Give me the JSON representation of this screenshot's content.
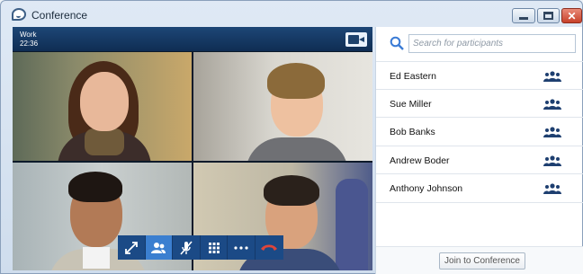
{
  "window": {
    "title": "Conference",
    "close_glyph": "✕"
  },
  "call": {
    "name": "Work",
    "time": "22:36"
  },
  "controls": [
    {
      "id": "expand",
      "icon": "expand-icon"
    },
    {
      "id": "participants",
      "icon": "participants-icon",
      "active": true
    },
    {
      "id": "mute",
      "icon": "microphone-muted-icon"
    },
    {
      "id": "dialpad",
      "icon": "dialpad-icon"
    },
    {
      "id": "more",
      "icon": "more-icon"
    },
    {
      "id": "hangup",
      "icon": "hangup-icon"
    }
  ],
  "search": {
    "placeholder": "Search for participants"
  },
  "participants": [
    {
      "name": "Ed Eastern"
    },
    {
      "name": "Sue Miller"
    },
    {
      "name": "Bob Banks"
    },
    {
      "name": "Andrew Boder"
    },
    {
      "name": "Anthony Johnson"
    }
  ],
  "footer": {
    "join_label": "Join to Conference"
  },
  "colors": {
    "header": "#1d4676",
    "control_bar": "#1b4a86",
    "control_active": "#3b7fd0",
    "hangup": "#e0453a",
    "participant_icon": "#1e3f70"
  }
}
